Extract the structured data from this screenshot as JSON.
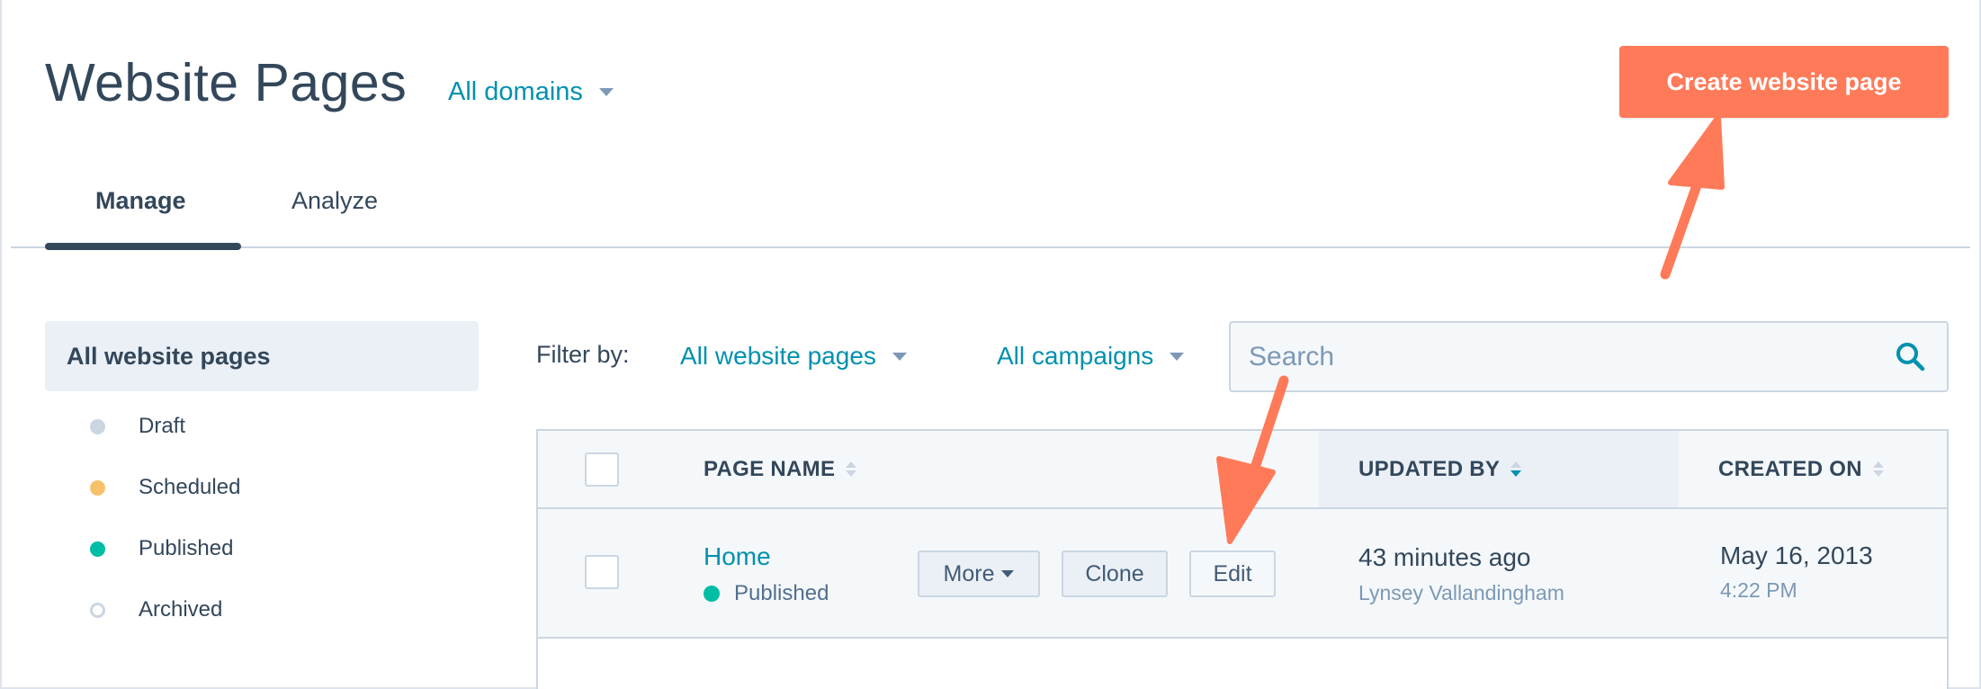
{
  "header": {
    "title": "Website Pages",
    "domain_filter": "All domains",
    "create_button": "Create website page"
  },
  "tabs": [
    {
      "label": "Manage",
      "active": true
    },
    {
      "label": "Analyze",
      "active": false
    }
  ],
  "sidebar": {
    "active_item": "All website pages",
    "items": [
      {
        "label": "Draft",
        "color": "#cbd6e2",
        "hollow": false
      },
      {
        "label": "Scheduled",
        "color": "#f5c26b",
        "hollow": false
      },
      {
        "label": "Published",
        "color": "#00bda5",
        "hollow": false
      },
      {
        "label": "Archived",
        "color": "#cbd6e2",
        "hollow": true
      }
    ]
  },
  "filters": {
    "label": "Filter by:",
    "pages": "All website pages",
    "campaigns": "All campaigns",
    "search_placeholder": "Search",
    "search_value": ""
  },
  "table": {
    "columns": [
      "PAGE NAME",
      "UPDATED BY",
      "CREATED ON"
    ],
    "sorted_column": "UPDATED BY",
    "rows": [
      {
        "page_name": "Home",
        "status": "Published",
        "status_color": "#00bda5",
        "actions": {
          "more": "More",
          "clone": "Clone",
          "edit": "Edit"
        },
        "updated": "43 minutes ago",
        "updated_by": "Lynsey Vallandingham",
        "created_date": "May 16, 2013",
        "created_time": "4:22 PM"
      }
    ]
  },
  "colors": {
    "accent_teal": "#0091ae",
    "cta_orange": "#ff7a59",
    "annotation_arrow": "#ff7a59",
    "text_dark": "#33475b"
  }
}
